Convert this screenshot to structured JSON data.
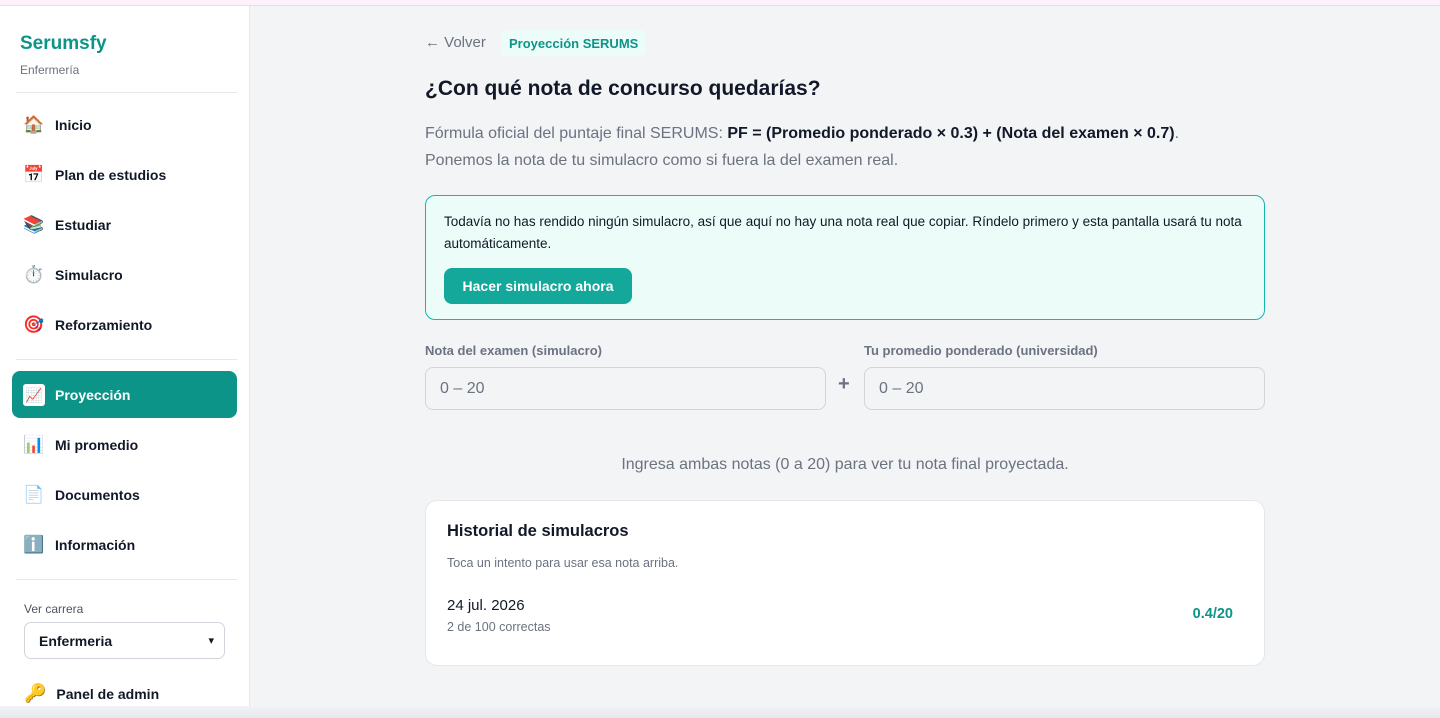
{
  "sidebar": {
    "brand": "Serumsfy",
    "brand_sub": "Enfermería",
    "items": [
      {
        "label": "Inicio",
        "icon": "🏠"
      },
      {
        "label": "Plan de estudios",
        "icon": "📅"
      },
      {
        "label": "Estudiar",
        "icon": "📚"
      },
      {
        "label": "Simulacro",
        "icon": "⏱️"
      },
      {
        "label": "Reforzamiento",
        "icon": "🎯"
      },
      {
        "label": "Proyección",
        "icon": "📈",
        "active": true
      },
      {
        "label": "Mi promedio",
        "icon": "📊"
      },
      {
        "label": "Documentos",
        "icon": "📄"
      },
      {
        "label": "Información",
        "icon": "ℹ️"
      }
    ],
    "career_label": "Ver carrera",
    "career_value": "Enfermeria",
    "admin_label": "Panel de admin",
    "admin_icon": "🔑"
  },
  "header": {
    "back_label": "← Volver",
    "chip": "Proyección SERUMS",
    "title": "¿Con qué nota de concurso quedarías?",
    "formula_prefix": "Fórmula oficial del puntaje final SERUMS: ",
    "formula": "PF = (Promedio ponderado × 0.3) + (Nota del examen × 0.7)",
    "formula_suffix": ".",
    "formula_line2": "Ponemos la nota de tu simulacro como si fuera la del examen real."
  },
  "notice": {
    "text": "Todavía no has rendido ningún simulacro, así que aquí no hay una nota real que copiar. Ríndelo primero y esta pantalla usará tu nota automáticamente.",
    "cta": "Hacer simulacro ahora"
  },
  "form": {
    "exam_label": "Nota del examen (simulacro)",
    "exam_placeholder": "0 – 20",
    "plus": "+",
    "avg_label": "Tu promedio ponderado (universidad)",
    "avg_placeholder": "0 – 20"
  },
  "hint": "Ingresa ambas notas (0 a 20) para ver tu nota final proyectada.",
  "history": {
    "title": "Historial de simulacros",
    "subtitle": "Toca un intento para usar esa nota arriba.",
    "attempts": [
      {
        "date": "24 jul. 2026",
        "detail": "2 de 100 correctas",
        "score": "0.4/20"
      }
    ]
  },
  "colors": {
    "accent": "#0d9488",
    "accent_light": "#ecfdf9"
  }
}
